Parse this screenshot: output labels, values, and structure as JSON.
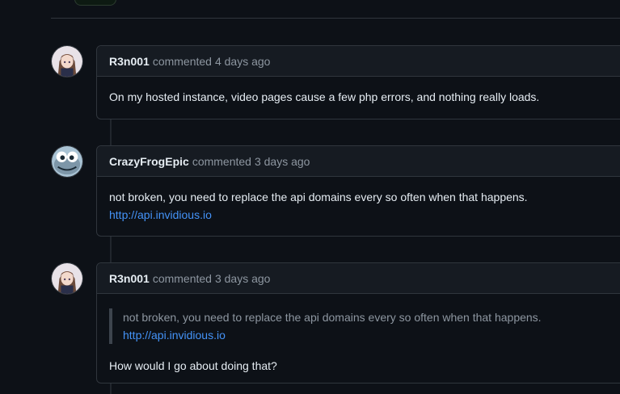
{
  "comments": [
    {
      "author": "R3n001",
      "action": "commented",
      "time": "4 days ago",
      "avatar": "anime-avatar",
      "body": [
        "On my hosted instance, video pages cause a few php errors, and nothing really loads."
      ]
    },
    {
      "author": "CrazyFrogEpic",
      "action": "commented",
      "time": "3 days ago",
      "avatar": "crazy-frog-avatar",
      "body": [
        "not broken, you need to replace the api domains every so often when that happens."
      ],
      "link": "http://api.invidious.io"
    },
    {
      "author": "R3n001",
      "action": "commented",
      "time": "3 days ago",
      "avatar": "anime-avatar",
      "quote": {
        "text": "not broken, you need to replace the api domains every so often when that happens.",
        "link": "http://api.invidious.io"
      },
      "body": [
        "How would I go about doing that?"
      ]
    }
  ],
  "colors": {
    "background": "#0d1117",
    "header": "#161b22",
    "border": "#30363d",
    "link": "#4493f8",
    "muted": "#8d96a0"
  }
}
